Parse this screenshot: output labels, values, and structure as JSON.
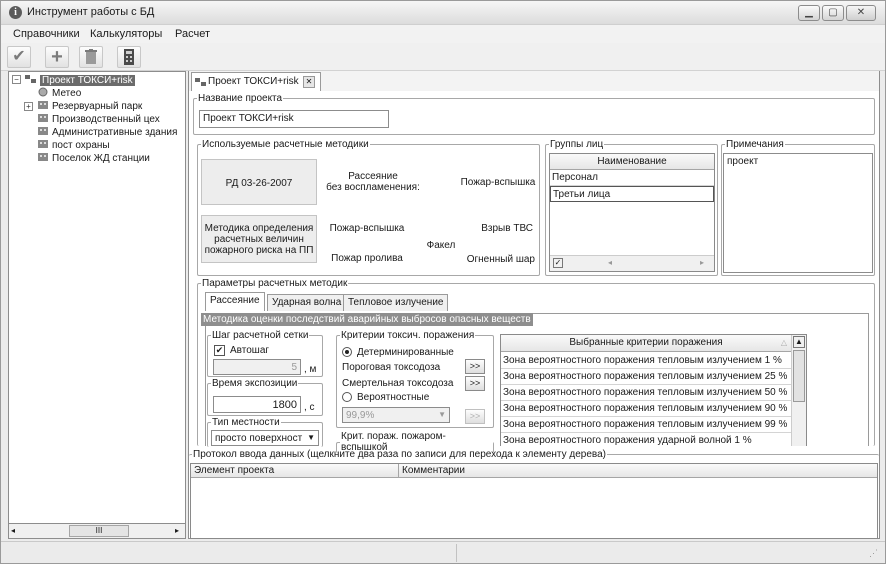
{
  "window": {
    "title": "Инструмент работы с БД"
  },
  "menu": [
    "Справочники",
    "Калькуляторы",
    "Расчет"
  ],
  "tree": {
    "root": "Проект ТОКСИ+risk",
    "items": [
      "Метео",
      "Резервуарный парк",
      "Производственный цех",
      "Административные здания",
      "пост охраны",
      "Поселок ЖД станции"
    ]
  },
  "doc_tab": "Проект ТОКСИ+risk",
  "project": {
    "name_legend": "Название проекта",
    "name_value": "Проект ТОКСИ+risk"
  },
  "methods": {
    "legend": "Используемые расчетные методики",
    "row1": {
      "name": "РД 03-26-2007",
      "scenario1": "Рассеяние\nбез воспламенения:",
      "scenario2": "Пожар-вспышка"
    },
    "row2": {
      "name": "Методика определения\nрасчетных величин\nпожарного риска на ПП",
      "s1": "Пожар-вспышка",
      "s2": "Взрыв ТВС",
      "s3": "Факел",
      "s4": "Пожар пролива",
      "s5": "Огненный шар"
    }
  },
  "groups": {
    "legend": "Группы лиц",
    "header": "Наименование",
    "rows": [
      "Персонал",
      "Третьи лица"
    ]
  },
  "notes": {
    "legend": "Примечания",
    "text": "проект"
  },
  "params": {
    "legend": "Параметры расчетных методик",
    "tabs": [
      "Рассеяние",
      "Ударная волна",
      "Тепловое излучение"
    ],
    "active_tab": "Рассеяние",
    "banner": "Методика оценки последствий аварийных выбросов опасных веществ",
    "grid_step": {
      "legend": "Шаг расчетной сетки",
      "auto_label": "Автошаг",
      "auto_checked": true,
      "value": "5",
      "unit": ", м"
    },
    "exposure": {
      "legend": "Время экспозиции",
      "value": "1800",
      "unit": ", с"
    },
    "terrain": {
      "legend": "Тип местности",
      "value": "просто поверхност"
    },
    "toxic": {
      "legend": "Критерии токсич. поражения",
      "det_label": "Детерминированные",
      "threshold_label": "Пороговая токсодоза",
      "lethal_label": "Смертельная токсодоза",
      "prob_label": "Вероятностные",
      "prob_value": "99,9%",
      "more": ">>"
    },
    "fire_legend": "Крит. пораж. пожаром-вспышкой",
    "criteria": {
      "header": "Выбранные критерии поражения",
      "rows": [
        "Зона вероятностного поражения тепловым излучением 1 %",
        "Зона вероятностного поражения тепловым излучением 25 %",
        "Зона вероятностного поражения тепловым излучением 50 %",
        "Зона вероятностного поражения тепловым излучением 90 %",
        "Зона вероятностного поражения тепловым излучением 99 %",
        "Зона вероятностного поражения ударной волной 1 %"
      ]
    }
  },
  "log": {
    "legend": "Протокол ввода данных (щелкните два раза по записи для перехода к элементу дерева)",
    "col1": "Элемент проекта",
    "col2": "Комментарии"
  },
  "tree_scroll_glyph": "III",
  "colors": {
    "selection": "#6b6b6b",
    "banner": "#8e8e8e",
    "check_green": "#3a7a3a"
  }
}
